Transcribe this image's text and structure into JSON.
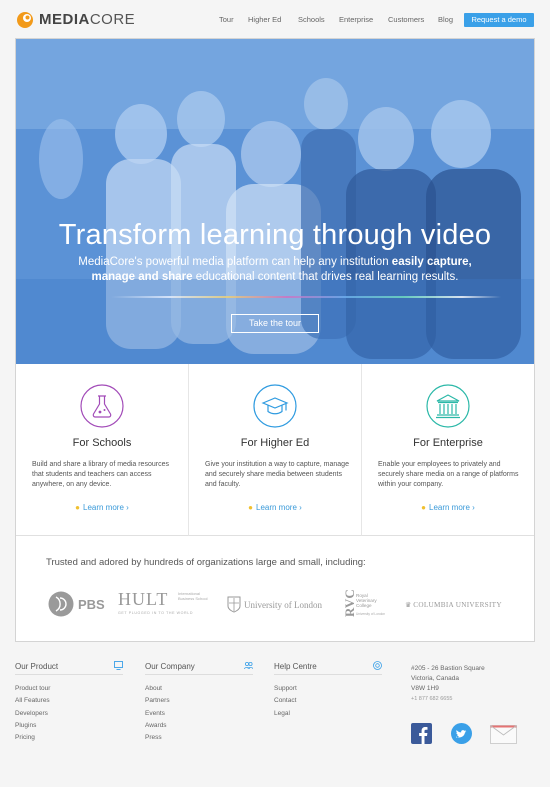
{
  "brand": {
    "name_bold": "MEDIA",
    "name_rest": "CORE",
    "accent": "#f29a1a"
  },
  "nav": {
    "items": [
      "Tour",
      "Higher Ed",
      "Schools",
      "Enterprise",
      "Customers",
      "Blog"
    ],
    "cta": "Request a demo",
    "cta_color": "#3aa0e8"
  },
  "hero": {
    "title": "Transform learning through video",
    "sub_lead": "MediaCore's powerful media platform can help any institution ",
    "sub_bold1": "easily capture,",
    "sub_bold2": "manage and share",
    "sub_tail": " educational content that drives real learning results.",
    "button": "Take the tour",
    "tint": "#3b78c6"
  },
  "columns": [
    {
      "icon": "flask-icon",
      "title": "For Schools",
      "desc": "Build and share a library of media resources that students and teachers can access anywhere, on any device.",
      "link": "Learn more",
      "color": "#a24bb8"
    },
    {
      "icon": "graduation-cap-icon",
      "title": "For Higher Ed",
      "desc": "Give your institution a way to capture, manage and securely share media between students and faculty.",
      "link": "Learn more",
      "color": "#2f9be0"
    },
    {
      "icon": "bank-building-icon",
      "title": "For Enterprise",
      "desc": "Enable your employees to privately and securely share media on a range of platforms within your company.",
      "link": "Learn more",
      "color": "#2bb8a8"
    }
  ],
  "trusted": {
    "text": "Trusted and adored by hundreds of organizations large and small, including:",
    "orgs": {
      "pbs": "PBS",
      "hult": "HULT",
      "hult_sub": "International Business School",
      "hult_tag": "GET PLUGGED IN TO THE WORLD",
      "london": "University of London",
      "rvc": "RVC",
      "rvc_sub": "Royal Veterinary College",
      "rvc_tag": "University of London",
      "columbia": "COLUMBIA UNIVERSITY"
    }
  },
  "footer": {
    "product": {
      "title": "Our Product",
      "icon": "monitor-icon",
      "links": [
        "Product tour",
        "All Features",
        "Developers",
        "Plugins",
        "Pricing"
      ]
    },
    "company": {
      "title": "Our Company",
      "icon": "people-icon",
      "links": [
        "About",
        "Partners",
        "Events",
        "Awards",
        "Press"
      ]
    },
    "help": {
      "title": "Help Centre",
      "icon": "lifebuoy-icon",
      "links": [
        "Support",
        "Contact",
        "Legal"
      ]
    },
    "address": {
      "line1": "#205 - 26 Bastion Square",
      "line2": "Victoria, Canada",
      "line3": "V8W 1H9",
      "phone": "+1 877 682 6655"
    },
    "social": [
      "facebook-icon",
      "twitter-icon",
      "mail-icon"
    ]
  }
}
